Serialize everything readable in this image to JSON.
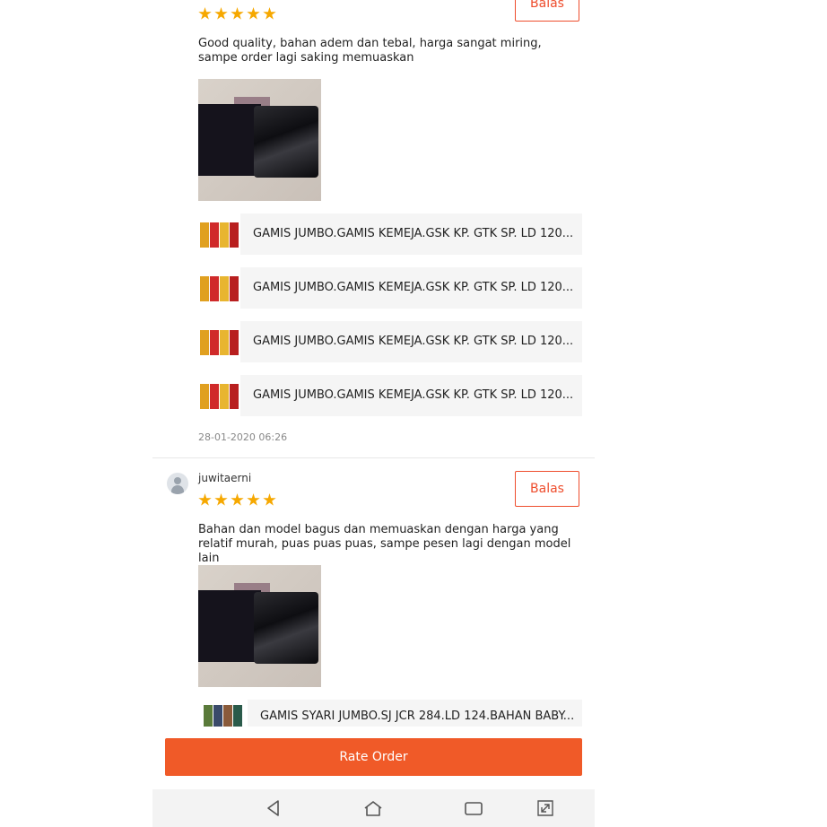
{
  "review1": {
    "rating": 5,
    "reply_label": "Balas",
    "text": "Good quality, bahan adem dan tebal, harga sangat miring, sampe order lagi saking memuaskan",
    "products": [
      "GAMIS JUMBO.GAMIS KEMEJA.GSK KP. GTK SP. LD 120...",
      "GAMIS JUMBO.GAMIS KEMEJA.GSK KP. GTK SP. LD 120...",
      "GAMIS JUMBO.GAMIS KEMEJA.GSK KP. GTK SP. LD 120...",
      "GAMIS JUMBO.GAMIS KEMEJA.GSK KP. GTK SP. LD 120..."
    ],
    "date": "28-01-2020 06:26"
  },
  "review2": {
    "username": "juwitaerni",
    "rating": 5,
    "reply_label": "Balas",
    "text": "Bahan dan model bagus dan memuaskan dengan harga yang relatif murah, puas puas puas, sampe pesen lagi dengan model lain",
    "products": [
      "GAMIS SYARI JUMBO.SJ JCR 284.LD 124.BAHAN BABY..."
    ]
  },
  "rate_order_label": "Rate Order",
  "nav": {
    "icons": [
      "back-icon",
      "home-icon",
      "recents-icon",
      "expand-icon"
    ]
  },
  "colors": {
    "accent": "#ee4d2d",
    "star": "#f6a800",
    "rate_button": "#f05a28"
  }
}
